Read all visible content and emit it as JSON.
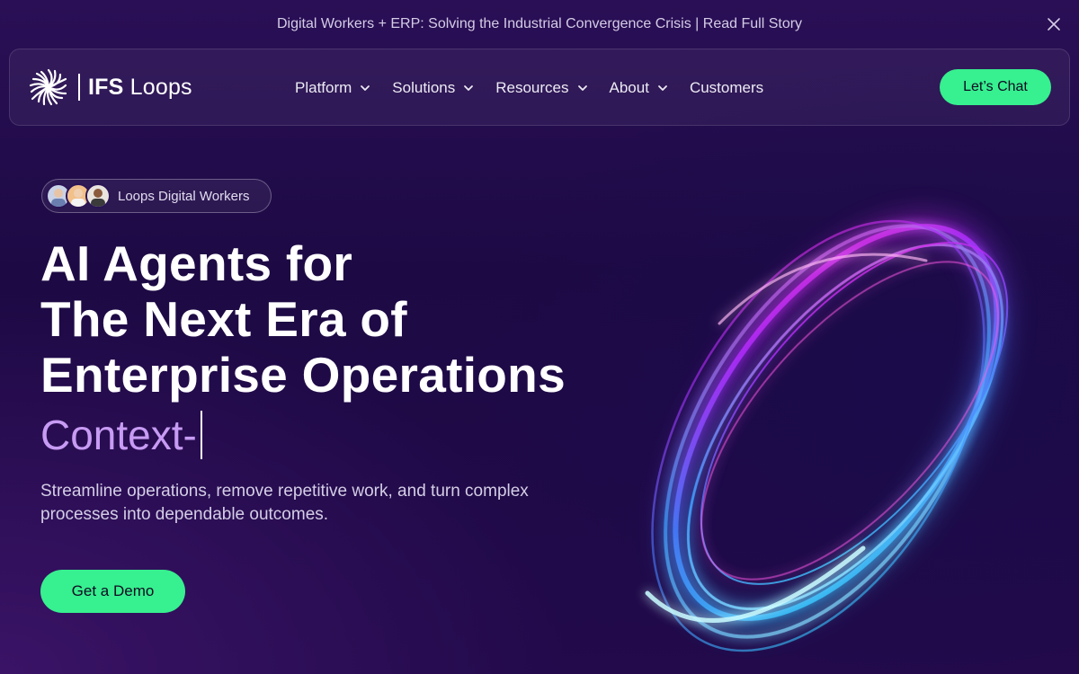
{
  "announcement": {
    "text": "Digital Workers + ERP: Solving the Industrial Convergence Crisis | Read Full Story"
  },
  "nav": {
    "logo_bold": "IFS",
    "logo_light": " Loops",
    "items": [
      {
        "label": "Platform"
      },
      {
        "label": "Solutions"
      },
      {
        "label": "Resources"
      },
      {
        "label": "About"
      },
      {
        "label": "Customers"
      }
    ],
    "cta_label": "Let’s Chat"
  },
  "hero": {
    "badge_label": "Loops Digital Workers",
    "headline_line1": "AI Agents for",
    "headline_line2": "The Next Era of",
    "headline_line3": "Enterprise Operations",
    "typed_text": "Context-",
    "subtitle": "Streamline operations, remove repetitive work, and turn complex processes into dependable outcomes.",
    "cta_label": "Get a Demo"
  },
  "colors": {
    "accent_green": "#37f08f",
    "typed_purple": "#c79bf3",
    "background": "#1d0a44"
  },
  "icons": {
    "close": "close-icon",
    "chevron": "chevron-down-icon",
    "logo": "ifs-starburst-logo"
  }
}
